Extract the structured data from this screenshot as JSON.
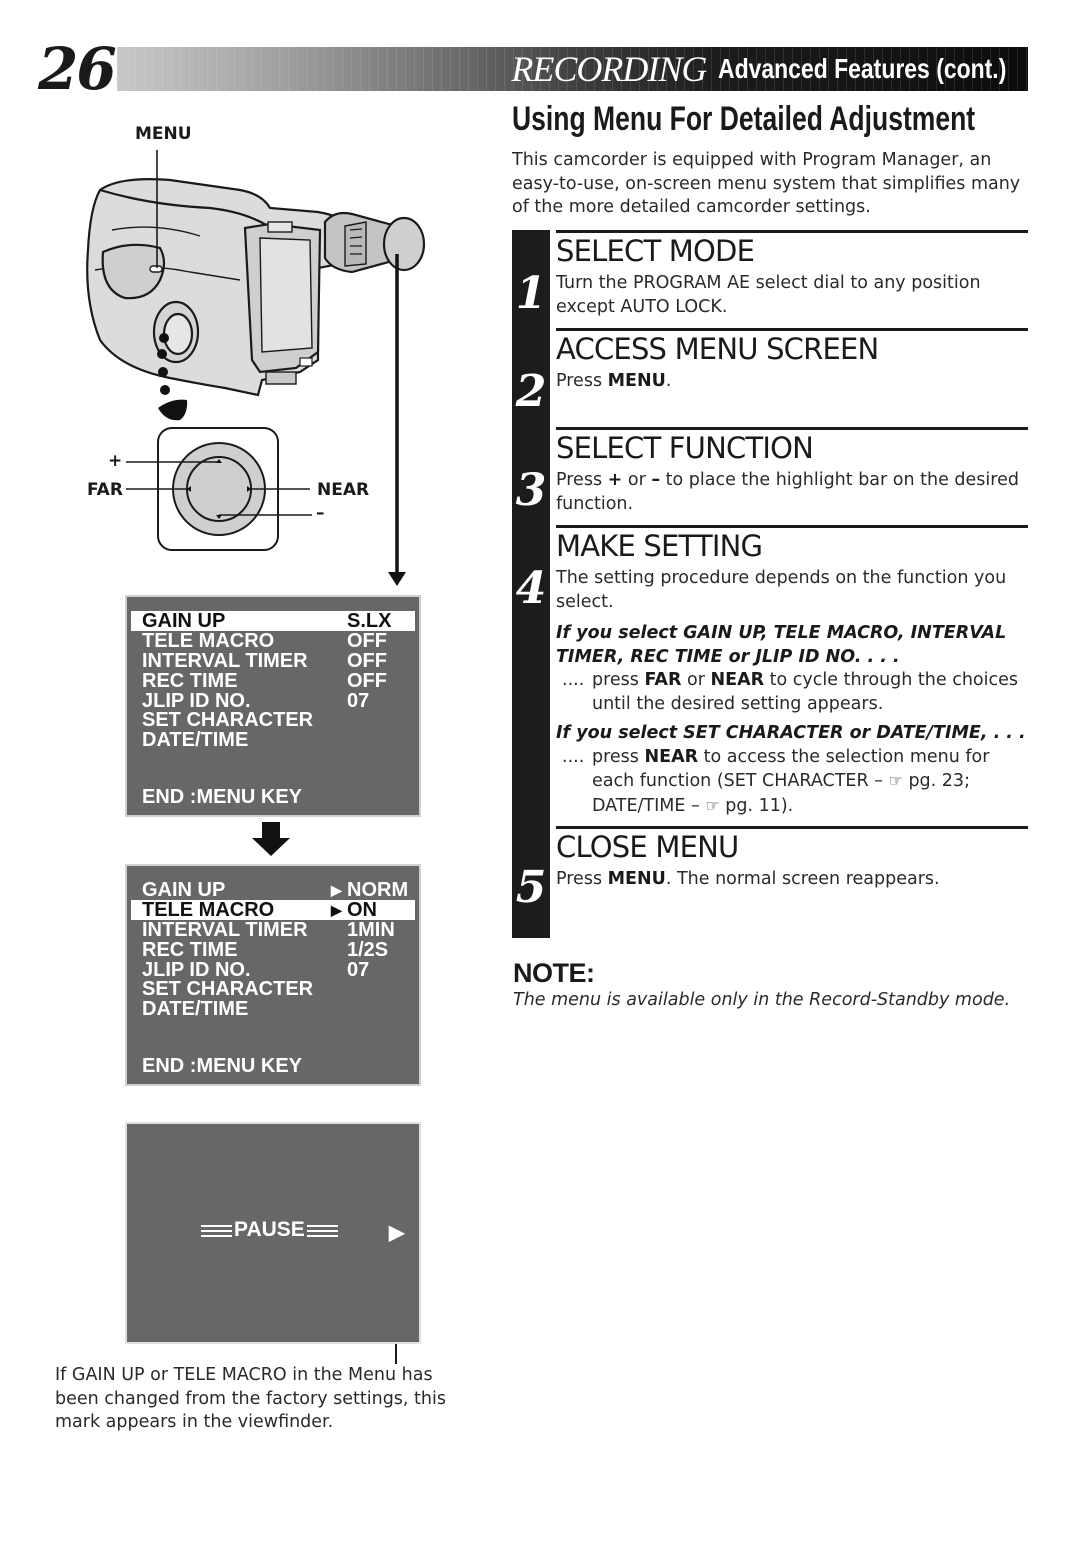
{
  "header": {
    "page_number": "26",
    "title_main": "RECORDING",
    "title_sub": "Advanced Features (cont.)"
  },
  "section": {
    "title": "Using Menu For Detailed Adjustment",
    "intro": "This camcorder is equipped with Program Manager, an easy-to-use, on-screen menu system that simplifies many of the more detailed camcorder settings."
  },
  "steps": [
    {
      "number": "1",
      "title": "SELECT MODE",
      "body": "Turn the PROGRAM AE select dial to any position except AUTO LOCK."
    },
    {
      "number": "2",
      "title": "ACCESS MENU SCREEN",
      "body_pre": "Press ",
      "body_bold": "MENU",
      "body_post": "."
    },
    {
      "number": "3",
      "title": "SELECT FUNCTION",
      "body_pre": "Press ",
      "body_plus": "+",
      "body_mid": " or ",
      "body_minus": "–",
      "body_post": " to place the highlight bar on the desired function."
    },
    {
      "number": "4",
      "title": "MAKE SETTING",
      "body": "The setting procedure depends on the function you select.",
      "cond1_head": "If you select GAIN UP, TELE MACRO, INTERVAL TIMER, REC TIME or JLIP ID NO. . . .",
      "cond1_dots": "....",
      "cond1_pre": "press ",
      "cond1_b1": "FAR",
      "cond1_mid": " or ",
      "cond1_b2": "NEAR",
      "cond1_post": " to cycle through the choices until the desired setting appears.",
      "cond2_head": "If you select SET CHARACTER or DATE/TIME, . . .",
      "cond2_dots": "....",
      "cond2_pre": "press ",
      "cond2_b1": "NEAR",
      "cond2_mid": " to access the selection menu for each function (SET CHARACTER – ",
      "cond2_ref1": "pg. 23;",
      "cond2_mid2": " DATE/TIME – ",
      "cond2_ref2": "pg. 11)."
    },
    {
      "number": "5",
      "title": "CLOSE MENU",
      "body_pre": "Press ",
      "body_bold": "MENU",
      "body_post": ". The normal screen reappears."
    }
  ],
  "note": {
    "title": "NOTE:",
    "text": "The menu is available only in the Record-Standby mode."
  },
  "illustration": {
    "menu_label": "MENU",
    "plus_label": "+",
    "far_label": "FAR",
    "near_label": "NEAR",
    "minus_label": "–",
    "pointer_icon": "☞"
  },
  "menu_screen_1": {
    "rows": [
      {
        "key": "GAIN UP",
        "value": "S.LX",
        "highlight": true
      },
      {
        "key": "TELE MACRO",
        "value": "OFF"
      },
      {
        "key": "INTERVAL TIMER",
        "value": "OFF"
      },
      {
        "key": "REC TIME",
        "value": "OFF"
      },
      {
        "key": "JLIP ID NO.",
        "value": "07"
      },
      {
        "key": "SET CHARACTER",
        "value": ""
      },
      {
        "key": "DATE/TIME",
        "value": ""
      }
    ],
    "footer": "END :MENU KEY"
  },
  "menu_screen_2": {
    "rows": [
      {
        "key": "GAIN UP",
        "value": "NORM",
        "arrow": "▶"
      },
      {
        "key": "TELE MACRO",
        "value": "ON",
        "arrow": "▶",
        "highlight": true
      },
      {
        "key": "INTERVAL TIMER",
        "value": "1MIN"
      },
      {
        "key": "REC TIME",
        "value": "1/2S"
      },
      {
        "key": "JLIP ID NO.",
        "value": "07"
      },
      {
        "key": "SET CHARACTER",
        "value": ""
      },
      {
        "key": "DATE/TIME",
        "value": ""
      }
    ],
    "footer": "END :MENU KEY"
  },
  "viewfinder_screen": {
    "status": "PAUSE",
    "mark": "▶"
  },
  "caption": "If GAIN UP or TELE MACRO in the Menu has been changed from the factory settings, this mark appears in the viewfinder."
}
